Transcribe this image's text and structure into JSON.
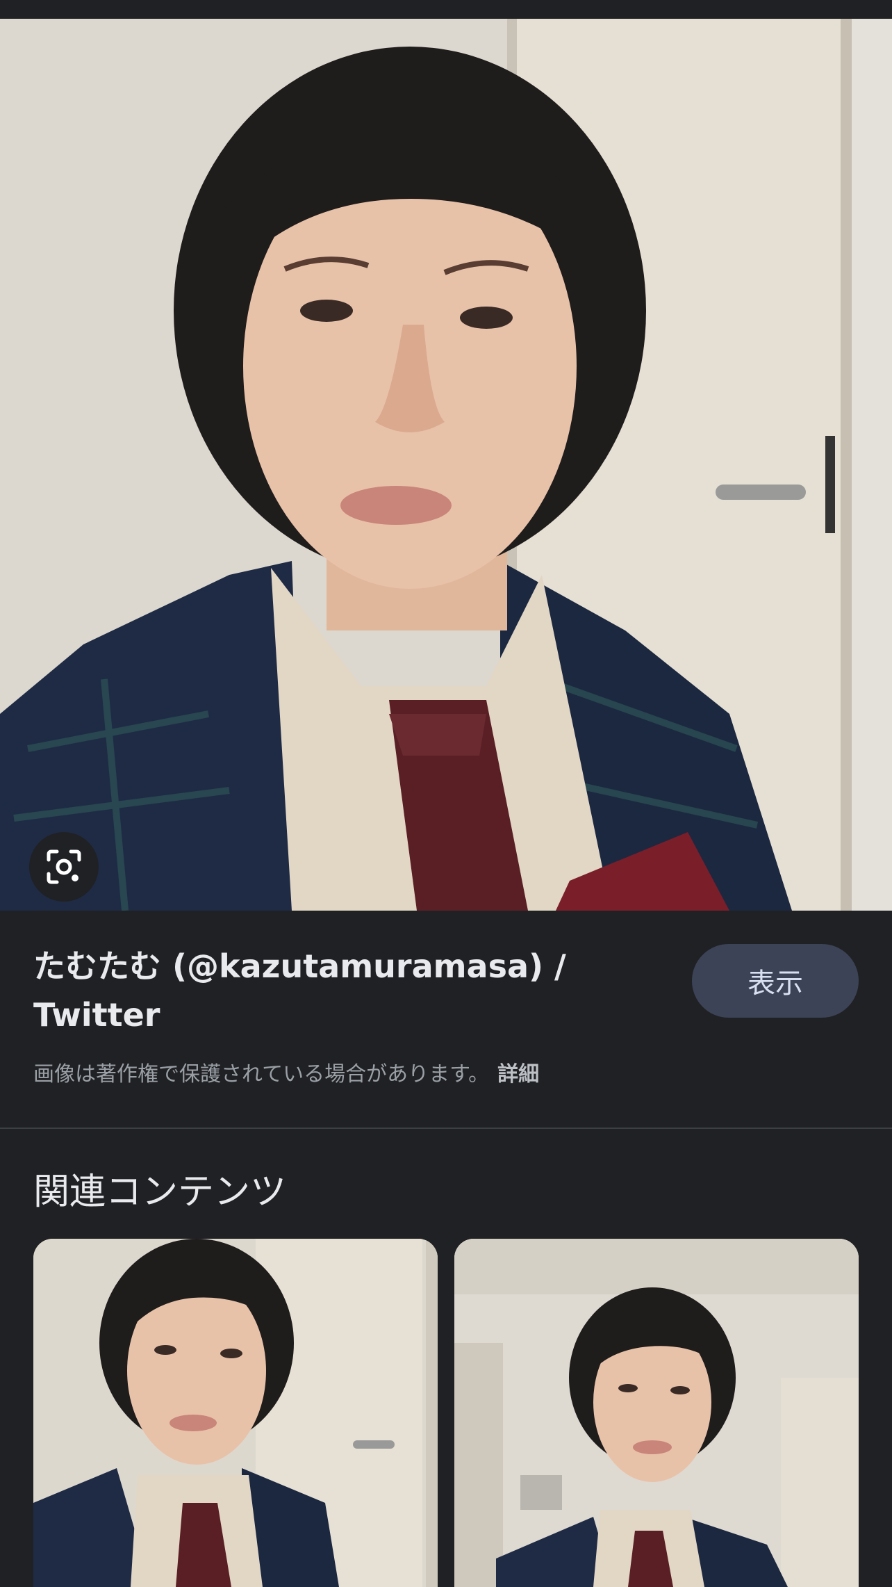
{
  "result": {
    "title": "たむたむ (@kazutamuramasa) / Twitter",
    "view_button": "表示",
    "copyright_notice": "画像は著作権で保護されている場合があります。",
    "details_link": "詳細"
  },
  "related": {
    "heading": "関連コンテンツ"
  },
  "icons": {
    "lens": "google-lens-icon"
  },
  "colors": {
    "background": "#202124",
    "button_bg": "#3c4357",
    "muted_text": "#9aa0a6"
  }
}
